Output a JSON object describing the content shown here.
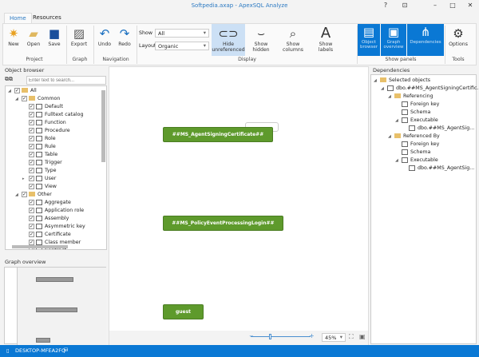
{
  "window": {
    "title": "Softpedia.axap - ApexSQL Analyze",
    "controls": [
      "?",
      "⊡",
      "–",
      "□",
      "✕"
    ]
  },
  "tabs": [
    "Home",
    "Resources"
  ],
  "ribbon": {
    "project": {
      "label": "Project",
      "buttons": [
        "New",
        "Open",
        "Save"
      ]
    },
    "graph": {
      "label": "Graph",
      "buttons": [
        "Export"
      ]
    },
    "navigation": {
      "label": "Navigation",
      "buttons": [
        "Undo",
        "Redo"
      ]
    },
    "display": {
      "label": "Display",
      "show_label": "Show",
      "show_value": "All",
      "layout_label": "Layout",
      "layout_value": "Organic",
      "buttons": [
        "Hide unreferenced",
        "Show hidden",
        "Show columns",
        "Show labels"
      ]
    },
    "show_panels": {
      "label": "Show panels",
      "buttons": [
        "Object browser",
        "Graph overview",
        "Dependencies"
      ]
    },
    "tools": {
      "label": "Tools",
      "buttons": [
        "Options"
      ]
    }
  },
  "object_browser": {
    "title": "Object browser",
    "search_placeholder": "Enter text to search...",
    "items": [
      {
        "label": "All",
        "level": 0,
        "folder": true
      },
      {
        "label": "Common",
        "level": 1,
        "folder": true
      },
      {
        "label": "Default",
        "level": 2
      },
      {
        "label": "Fulltext catalog",
        "level": 2
      },
      {
        "label": "Function",
        "level": 2
      },
      {
        "label": "Procedure",
        "level": 2
      },
      {
        "label": "Role",
        "level": 2
      },
      {
        "label": "Rule",
        "level": 2
      },
      {
        "label": "Table",
        "level": 2
      },
      {
        "label": "Trigger",
        "level": 2
      },
      {
        "label": "Type",
        "level": 2
      },
      {
        "label": "User",
        "level": 2
      },
      {
        "label": "View",
        "level": 2
      },
      {
        "label": "Other",
        "level": 1,
        "folder": true
      },
      {
        "label": "Aggregate",
        "level": 2
      },
      {
        "label": "Application role",
        "level": 2
      },
      {
        "label": "Assembly",
        "level": 2
      },
      {
        "label": "Asymmetric key",
        "level": 2
      },
      {
        "label": "Certificate",
        "level": 2
      },
      {
        "label": "Class member",
        "level": 2
      },
      {
        "label": "Contract",
        "level": 2
      }
    ]
  },
  "graph_overview": {
    "title": "Graph overview"
  },
  "canvas": {
    "nodes": [
      "##MS_AgentSigningCertificate##",
      "##MS_PolicyEventProcessingLogin##",
      "guest"
    ],
    "zoom": "45%"
  },
  "dependencies": {
    "title": "Dependencies",
    "items": [
      {
        "label": "Selected objects",
        "level": 0,
        "folder": true
      },
      {
        "label": "dbo.##MS_AgentSigningCertific...",
        "level": 1
      },
      {
        "label": "Referencing",
        "level": 2,
        "folder": true
      },
      {
        "label": "Foreign key",
        "level": 3
      },
      {
        "label": "Schema",
        "level": 3
      },
      {
        "label": "Executable",
        "level": 3
      },
      {
        "label": "dbo.##MS_AgentSig...",
        "level": 4
      },
      {
        "label": "Referenced By",
        "level": 2,
        "folder": true
      },
      {
        "label": "Foreign key",
        "level": 3
      },
      {
        "label": "Schema",
        "level": 3
      },
      {
        "label": "Executable",
        "level": 3
      },
      {
        "label": "dbo.##MS_AgentSig...",
        "level": 4
      }
    ]
  },
  "status": {
    "machine": "DESKTOP-MFEA2FQ"
  }
}
